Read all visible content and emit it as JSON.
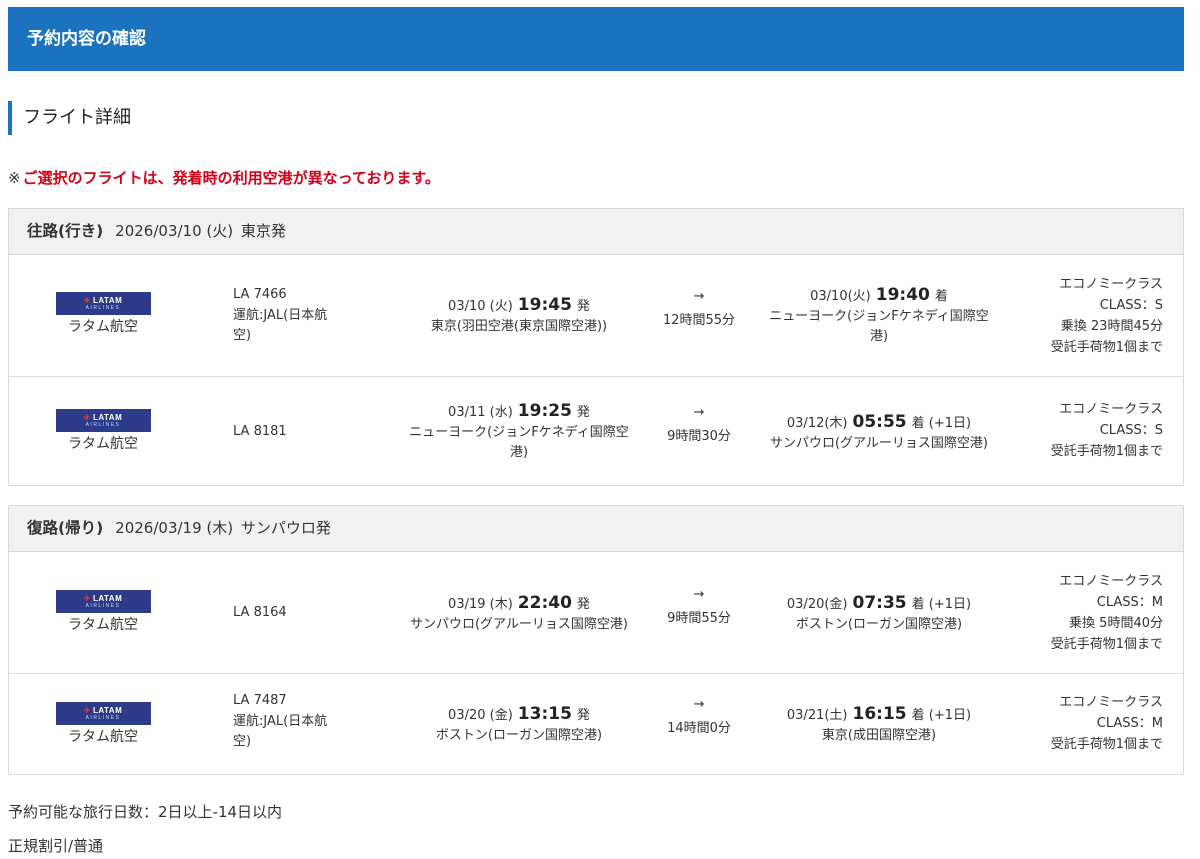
{
  "header": {
    "title": "予約内容の確認"
  },
  "section": {
    "title": "フライト詳細"
  },
  "notice": {
    "mark": "※",
    "text": "ご選択のフライトは、発着時の利用空港が異なっております。"
  },
  "legs": [
    {
      "direction": "往路(行き)",
      "date": "2026/03/10 (火)",
      "origin": "東京発",
      "segments": [
        {
          "logo_text": "LATAM",
          "logo_sub": "AIRLINES",
          "airline": "ラタム航空",
          "flight_lines": [
            "LA 7466",
            "運航:JAL(日本航",
            "空)"
          ],
          "dep_date": "03/10 (火)",
          "dep_time": "19:45",
          "dep_suffix": "発",
          "dep_airport_lines": [
            "東京(羽田空港(東京国際空港))"
          ],
          "arrow": "→",
          "duration": "12時間55分",
          "arr_date": "03/10(火)",
          "arr_time": "19:40",
          "arr_suffix": "着",
          "arr_next": "",
          "arr_airport_lines": [
            "ニューヨーク(ジョンFケネディ国際空",
            "港)"
          ],
          "class_lines": [
            "エコノミークラス",
            "CLASS：S",
            "乗換 23時間45分",
            "受託手荷物1個まで"
          ]
        },
        {
          "logo_text": "LATAM",
          "logo_sub": "AIRLINES",
          "airline": "ラタム航空",
          "flight_lines": [
            "LA 8181"
          ],
          "dep_date": "03/11 (水)",
          "dep_time": "19:25",
          "dep_suffix": "発",
          "dep_airport_lines": [
            "ニューヨーク(ジョンFケネディ国際空",
            "港)"
          ],
          "arrow": "→",
          "duration": "9時間30分",
          "arr_date": "03/12(木)",
          "arr_time": "05:55",
          "arr_suffix": "着",
          "arr_next": "(+1日)",
          "arr_airport_lines": [
            "サンパウロ(グアルーリョス国際空港)"
          ],
          "class_lines": [
            "エコノミークラス",
            "CLASS：S",
            "受託手荷物1個まで"
          ]
        }
      ]
    },
    {
      "direction": "復路(帰り)",
      "date": "2026/03/19 (木)",
      "origin": "サンパウロ発",
      "segments": [
        {
          "logo_text": "LATAM",
          "logo_sub": "AIRLINES",
          "airline": "ラタム航空",
          "flight_lines": [
            "LA 8164"
          ],
          "dep_date": "03/19 (木)",
          "dep_time": "22:40",
          "dep_suffix": "発",
          "dep_airport_lines": [
            "サンパウロ(グアルーリョス国際空港)"
          ],
          "arrow": "→",
          "duration": "9時間55分",
          "arr_date": "03/20(金)",
          "arr_time": "07:35",
          "arr_suffix": "着",
          "arr_next": "(+1日)",
          "arr_airport_lines": [
            "ボストン(ローガン国際空港)"
          ],
          "class_lines": [
            "エコノミークラス",
            "CLASS：M",
            "乗換 5時間40分",
            "受託手荷物1個まで"
          ]
        },
        {
          "logo_text": "LATAM",
          "logo_sub": "AIRLINES",
          "airline": "ラタム航空",
          "flight_lines": [
            "LA 7487",
            "運航:JAL(日本航",
            "空)"
          ],
          "dep_date": "03/20 (金)",
          "dep_time": "13:15",
          "dep_suffix": "発",
          "dep_airport_lines": [
            "ボストン(ローガン国際空港)"
          ],
          "arrow": "→",
          "duration": "14時間0分",
          "arr_date": "03/21(土)",
          "arr_time": "16:15",
          "arr_suffix": "着",
          "arr_next": "(+1日)",
          "arr_airport_lines": [
            "東京(成田国際空港)"
          ],
          "class_lines": [
            "エコノミークラス",
            "CLASS：M",
            "受託手荷物1個まで"
          ]
        }
      ]
    }
  ],
  "footer": {
    "travel_days": "予約可能な旅行日数：2日以上-14日以内",
    "fare_type": "正規割引/普通"
  },
  "colors": {
    "header_bg": "#1b72be",
    "notice": "#d0021b",
    "logo_bg": "#2b3b8a"
  }
}
